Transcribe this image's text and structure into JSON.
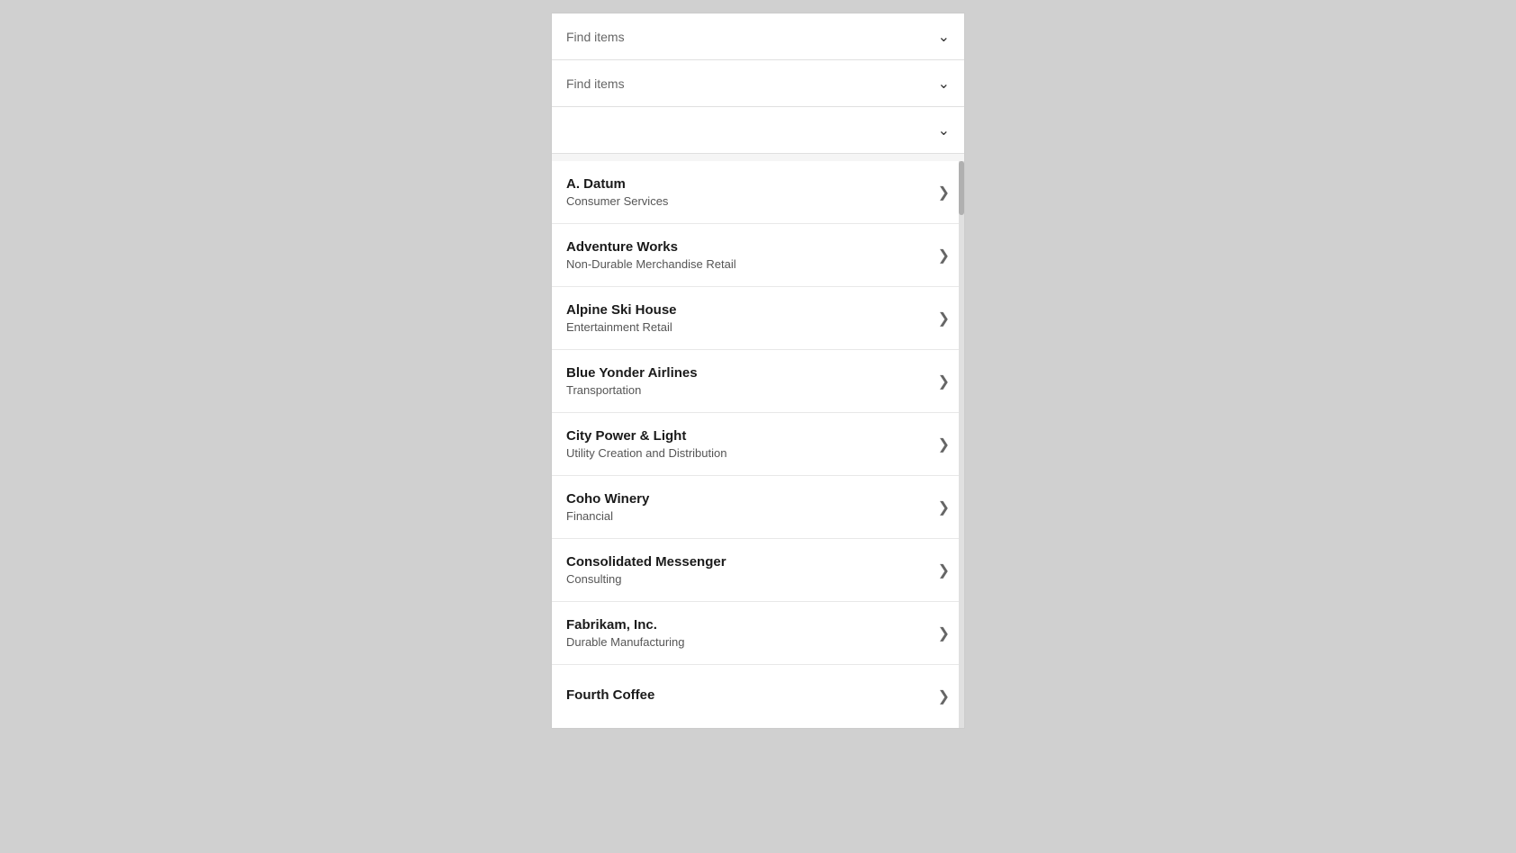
{
  "dropdowns": [
    {
      "id": "dropdown-1",
      "placeholder": "Find items",
      "hasText": true
    },
    {
      "id": "dropdown-2",
      "placeholder": "Find items",
      "hasText": true
    },
    {
      "id": "dropdown-3",
      "placeholder": "",
      "hasText": false
    }
  ],
  "list_items": [
    {
      "id": "item-a-datum",
      "title": "A. Datum",
      "subtitle": "Consumer Services"
    },
    {
      "id": "item-adventure-works",
      "title": "Adventure Works",
      "subtitle": "Non-Durable Merchandise Retail"
    },
    {
      "id": "item-alpine-ski-house",
      "title": "Alpine Ski House",
      "subtitle": "Entertainment Retail"
    },
    {
      "id": "item-blue-yonder-airlines",
      "title": "Blue Yonder Airlines",
      "subtitle": "Transportation"
    },
    {
      "id": "item-city-power-light",
      "title": "City Power & Light",
      "subtitle": "Utility Creation and Distribution"
    },
    {
      "id": "item-coho-winery",
      "title": "Coho Winery",
      "subtitle": "Financial"
    },
    {
      "id": "item-consolidated-messenger",
      "title": "Consolidated Messenger",
      "subtitle": "Consulting"
    },
    {
      "id": "item-fabrikam",
      "title": "Fabrikam, Inc.",
      "subtitle": "Durable Manufacturing"
    },
    {
      "id": "item-fourth-coffee",
      "title": "Fourth Coffee",
      "subtitle": ""
    }
  ],
  "icons": {
    "chevron_down": "⌄",
    "chevron_right": "›"
  }
}
